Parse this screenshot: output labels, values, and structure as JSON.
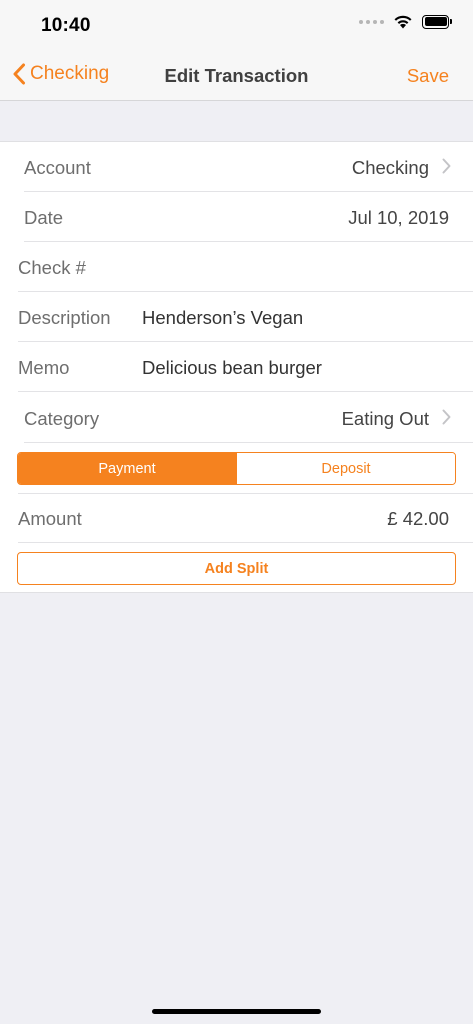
{
  "status": {
    "time": "10:40"
  },
  "nav": {
    "back_label": "Checking",
    "title": "Edit Transaction",
    "save_label": "Save"
  },
  "rows": {
    "account": {
      "label": "Account",
      "value": "Checking"
    },
    "date": {
      "label": "Date",
      "value": "Jul 10, 2019"
    },
    "check": {
      "label": "Check #",
      "value": ""
    },
    "description": {
      "label": "Description",
      "value": "Henderson’s Vegan"
    },
    "memo": {
      "label": "Memo",
      "value": "Delicious bean burger"
    },
    "category": {
      "label": "Category",
      "value": "Eating Out"
    },
    "amount": {
      "label": "Amount",
      "value": "£ 42.00"
    }
  },
  "segment": {
    "payment_label": "Payment",
    "deposit_label": "Deposit",
    "selected": "Payment"
  },
  "add_split_label": "Add Split",
  "colors": {
    "accent": "#f5821f",
    "background": "#efeff4",
    "bar": "#f7f7f7"
  },
  "icons": {
    "back": "chevron-left-icon",
    "disclosure": "chevron-right-icon",
    "wifi": "wifi-icon",
    "battery": "battery-icon",
    "signal": "signal-icon"
  }
}
